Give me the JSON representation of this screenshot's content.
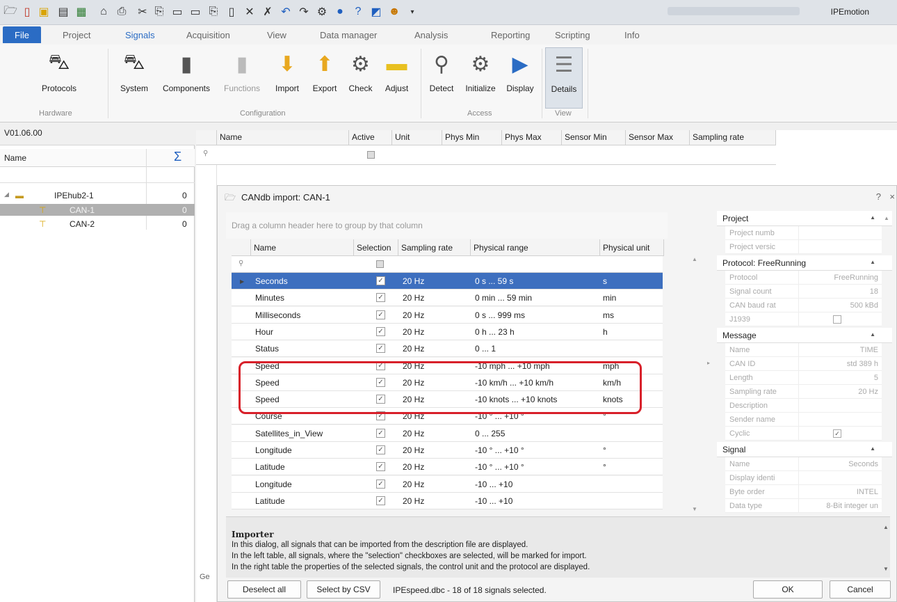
{
  "window": {
    "title": "IPEmotion"
  },
  "menu": {
    "file": "File",
    "items": [
      "Project",
      "Signals",
      "Acquisition",
      "View",
      "Data manager",
      "Analysis",
      "Reporting",
      "Scripting",
      "Info"
    ]
  },
  "ribbon": {
    "buttons": {
      "protocols": "Protocols",
      "system": "System",
      "components": "Components",
      "functions": "Functions",
      "import": "Import",
      "export": "Export",
      "check": "Check",
      "adjust": "Adjust",
      "detect": "Detect",
      "initialize": "Initialize",
      "display": "Display",
      "details": "Details"
    },
    "groups": {
      "hardware": "Hardware",
      "configuration": "Configuration",
      "access": "Access",
      "view": "View"
    }
  },
  "left": {
    "version": "V01.06.00",
    "name_header": "Name",
    "sum_symbol": "Σ",
    "tree": [
      {
        "label": "IPEhub2-1",
        "count": "0"
      },
      {
        "label": "CAN-1",
        "count": "0"
      },
      {
        "label": "CAN-2",
        "count": "0"
      }
    ]
  },
  "grid": {
    "headers": [
      "Name",
      "Active",
      "Unit",
      "Phys Min",
      "Phys Max",
      "Sensor Min",
      "Sensor Max",
      "Sampling rate"
    ]
  },
  "dialog": {
    "title": "CANdb import: CAN-1",
    "help": "?",
    "close": "×",
    "group_hint": "Drag a column header here to group by that column",
    "headers": {
      "name": "Name",
      "selection": "Selection",
      "rate": "Sampling rate",
      "range": "Physical range",
      "unit": "Physical unit"
    },
    "rows": [
      {
        "name": "Seconds",
        "rate": "20 Hz",
        "range": "0 s ... 59 s",
        "unit": "s"
      },
      {
        "name": "Minutes",
        "rate": "20 Hz",
        "range": "0 min ... 59 min",
        "unit": "min"
      },
      {
        "name": "Milliseconds",
        "rate": "20 Hz",
        "range": "0 s ... 999 ms",
        "unit": "ms"
      },
      {
        "name": "Hour",
        "rate": "20 Hz",
        "range": "0 h ... 23 h",
        "unit": "h"
      },
      {
        "name": "Status",
        "rate": "20 Hz",
        "range": "0 ... 1",
        "unit": ""
      },
      {
        "name": "Speed",
        "rate": "20 Hz",
        "range": "-10 mph ... +10 mph",
        "unit": "mph"
      },
      {
        "name": "Speed",
        "rate": "20 Hz",
        "range": "-10 km/h ... +10 km/h",
        "unit": "km/h"
      },
      {
        "name": "Speed",
        "rate": "20 Hz",
        "range": "-10 knots ... +10 knots",
        "unit": "knots"
      },
      {
        "name": "Course",
        "rate": "20 Hz",
        "range": "-10 ° ... +10 °",
        "unit": "°"
      },
      {
        "name": "Satellites_in_View",
        "rate": "20 Hz",
        "range": "0 ... 255",
        "unit": ""
      },
      {
        "name": "Longitude",
        "rate": "20 Hz",
        "range": "-10 ° ... +10 °",
        "unit": "°"
      },
      {
        "name": "Latitude",
        "rate": "20 Hz",
        "range": "-10 ° ... +10 °",
        "unit": "°"
      },
      {
        "name": "Longitude",
        "rate": "20 Hz",
        "range": "-10 ... +10",
        "unit": ""
      },
      {
        "name": "Latitude",
        "rate": "20 Hz",
        "range": "-10 ... +10",
        "unit": ""
      }
    ],
    "properties": {
      "project": {
        "title": "Project",
        "items": [
          [
            "Project numb",
            ""
          ],
          [
            "Project versic",
            ""
          ]
        ]
      },
      "protocol": {
        "title": "Protocol: FreeRunning",
        "items": [
          [
            "Protocol",
            "FreeRunning"
          ],
          [
            "Signal count",
            "18"
          ],
          [
            "CAN baud rat",
            "500 kBd"
          ],
          [
            "J1939",
            ""
          ]
        ]
      },
      "message": {
        "title": "Message",
        "items": [
          [
            "Name",
            "TIME"
          ],
          [
            "CAN ID",
            "std      389 h"
          ],
          [
            "Length",
            "5"
          ],
          [
            "Sampling rate",
            "20 Hz"
          ],
          [
            "Description",
            ""
          ],
          [
            "Sender name",
            ""
          ],
          [
            "Cyclic",
            ""
          ]
        ]
      },
      "signal": {
        "title": "Signal",
        "items": [
          [
            "Name",
            "Seconds"
          ],
          [
            "Display identi",
            ""
          ],
          [
            "Byte order",
            "INTEL"
          ],
          [
            "Data type",
            "8-Bit integer un"
          ]
        ]
      }
    },
    "importer": {
      "title": "Importer",
      "lines": [
        "In this dialog, all signals that can be imported from the description file are displayed.",
        "In the left table, all signals, where the \"selection\" checkboxes are selected, will be marked for import.",
        "In the right table the properties of the selected signals, the control unit and the protocol are displayed."
      ]
    },
    "footer": {
      "deselect": "Deselect all",
      "select_csv": "Select by CSV",
      "status": "IPEspeed.dbc  -  18 of 18 signals selected.",
      "ok": "OK",
      "cancel": "Cancel",
      "tab_stub": "Ge"
    }
  }
}
